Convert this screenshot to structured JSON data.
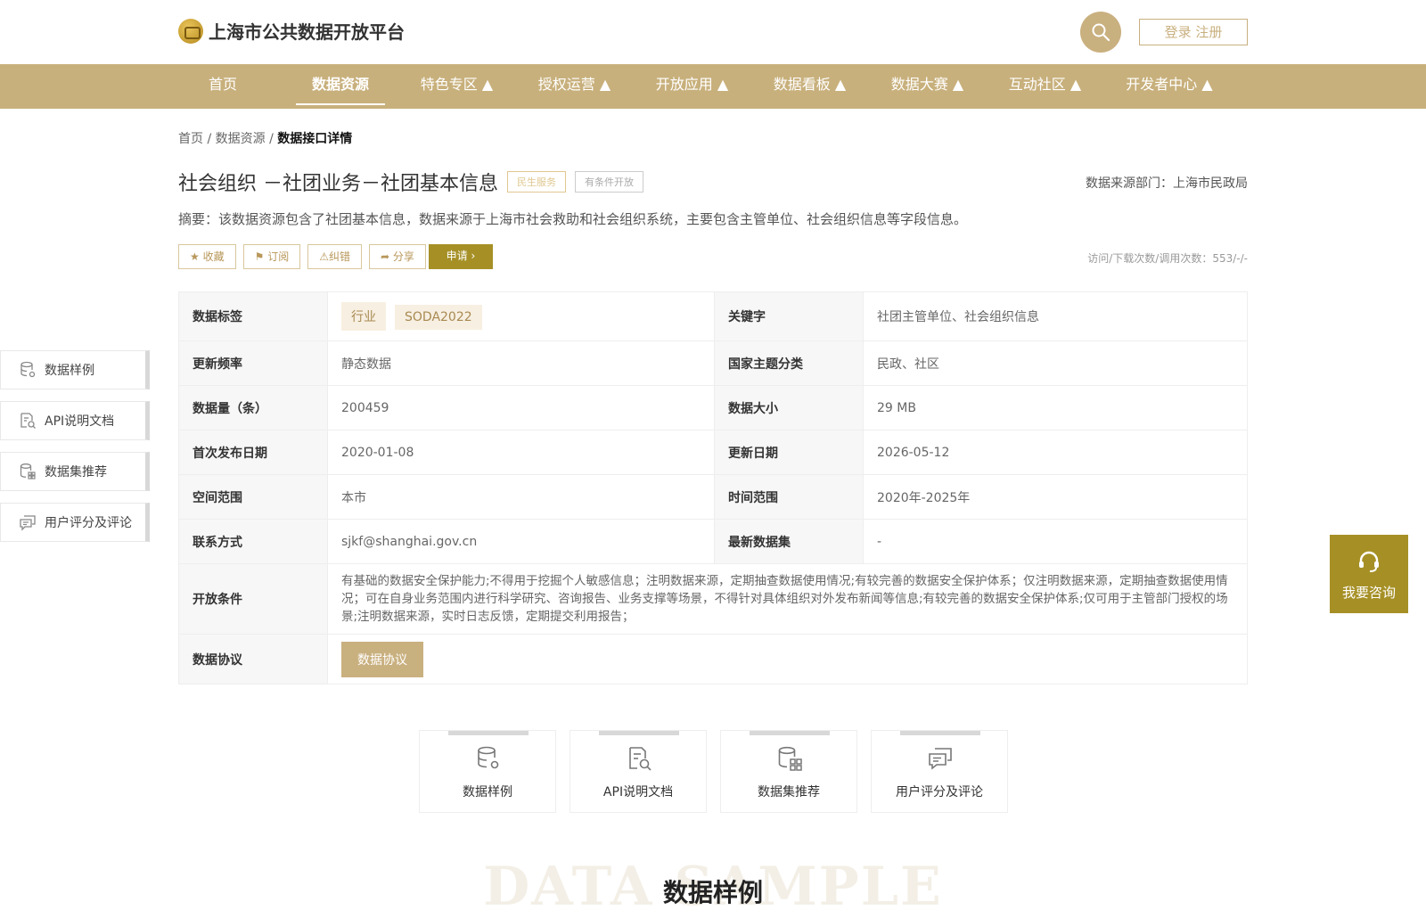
{
  "header": {
    "logo_text": "上海市公共数据开放平台",
    "login_label": "登录 注册"
  },
  "nav": [
    {
      "label": "首页",
      "active": false
    },
    {
      "label": "数据资源",
      "active": true
    },
    {
      "label": "特色专区 ▲",
      "active": false
    },
    {
      "label": "授权运营 ▲",
      "active": false
    },
    {
      "label": "开放应用 ▲",
      "active": false
    },
    {
      "label": "数据看板 ▲",
      "active": false
    },
    {
      "label": "数据大赛 ▲",
      "active": false
    },
    {
      "label": "互动社区 ▲",
      "active": false
    },
    {
      "label": "开发者中心 ▲",
      "active": false
    }
  ],
  "breadcrumb": {
    "home": "首页",
    "sep1": " / ",
    "resources": "数据资源",
    "sep2": " / ",
    "current": "数据接口详情"
  },
  "detail": {
    "title": "社会组织 －社团业务－社团基本信息",
    "tag_service": "民生服务",
    "tag_open": "有条件开放",
    "source_dept": "数据来源部门：上海市民政局",
    "abstract": "摘要：该数据资源包含了社团基本信息，数据来源于上海市社会救助和社会组织系统，主要包含主管单位、社会组织信息等字段信息。",
    "actions": {
      "favorite": "收藏",
      "subscribe": "订阅",
      "correct": "纠错",
      "share": "分享",
      "apply": "申请"
    },
    "visit_count": "访问/下载次数/调用次数：553/-/-"
  },
  "table": {
    "tags_key": "数据标签",
    "tags": [
      "行业",
      "SODA2022"
    ],
    "keywords_key": "关键字",
    "keywords_val": "社团主管单位、社会组织信息",
    "freq_key": "更新频率",
    "freq_val": "静态数据",
    "theme_key": "国家主题分类",
    "theme_val": "民政、社区",
    "count_key": "数据量（条）",
    "count_val": "200459",
    "size_key": "数据大小",
    "size_val": "29 MB",
    "first_pub_key": "首次发布日期",
    "first_pub_val": "2020-01-08",
    "update_key": "更新日期",
    "update_val": "2026-05-12",
    "space_key": "空间范围",
    "space_val": "本市",
    "time_key": "时间范围",
    "time_val": "2020年-2025年",
    "contact_key": "联系方式",
    "contact_val": "sjkf@shanghai.gov.cn",
    "latest_key": "最新数据集",
    "latest_val": "-",
    "cond_key": "开放条件",
    "cond_val": "有基础的数据安全保护能力;不得用于挖掘个人敏感信息；注明数据来源，定期抽查数据使用情况;有较完善的数据安全保护体系；仅注明数据来源，定期抽查数据使用情况；可在自身业务范围内进行科学研究、咨询报告、业务支撑等场景，不得针对具体组织对外发布新闻等信息;有较完善的数据安全保护体系;仅可用于主管部门授权的场景;注明数据来源，实时日志反馈，定期提交利用报告；",
    "proto_key": "数据协议",
    "proto_btn": "数据协议"
  },
  "side_nav": [
    {
      "label": "数据样例",
      "icon": "database-gear-icon"
    },
    {
      "label": "API说明文档",
      "icon": "doc-search-icon"
    },
    {
      "label": "数据集推荐",
      "icon": "database-grid-icon"
    },
    {
      "label": "用户评分及评论",
      "icon": "comments-icon"
    }
  ],
  "consult_label": "我要咨询",
  "cards": [
    {
      "label": "数据样例",
      "icon": "database-gear-icon"
    },
    {
      "label": "API说明文档",
      "icon": "doc-search-icon"
    },
    {
      "label": "数据集推荐",
      "icon": "database-grid-icon"
    },
    {
      "label": "用户评分及评论",
      "icon": "comments-icon"
    }
  ],
  "section": {
    "bg_text": "DATA SAMPLE",
    "title": "数据样例"
  },
  "colors": {
    "brand": "#c8b07c",
    "accent": "#a69026"
  }
}
